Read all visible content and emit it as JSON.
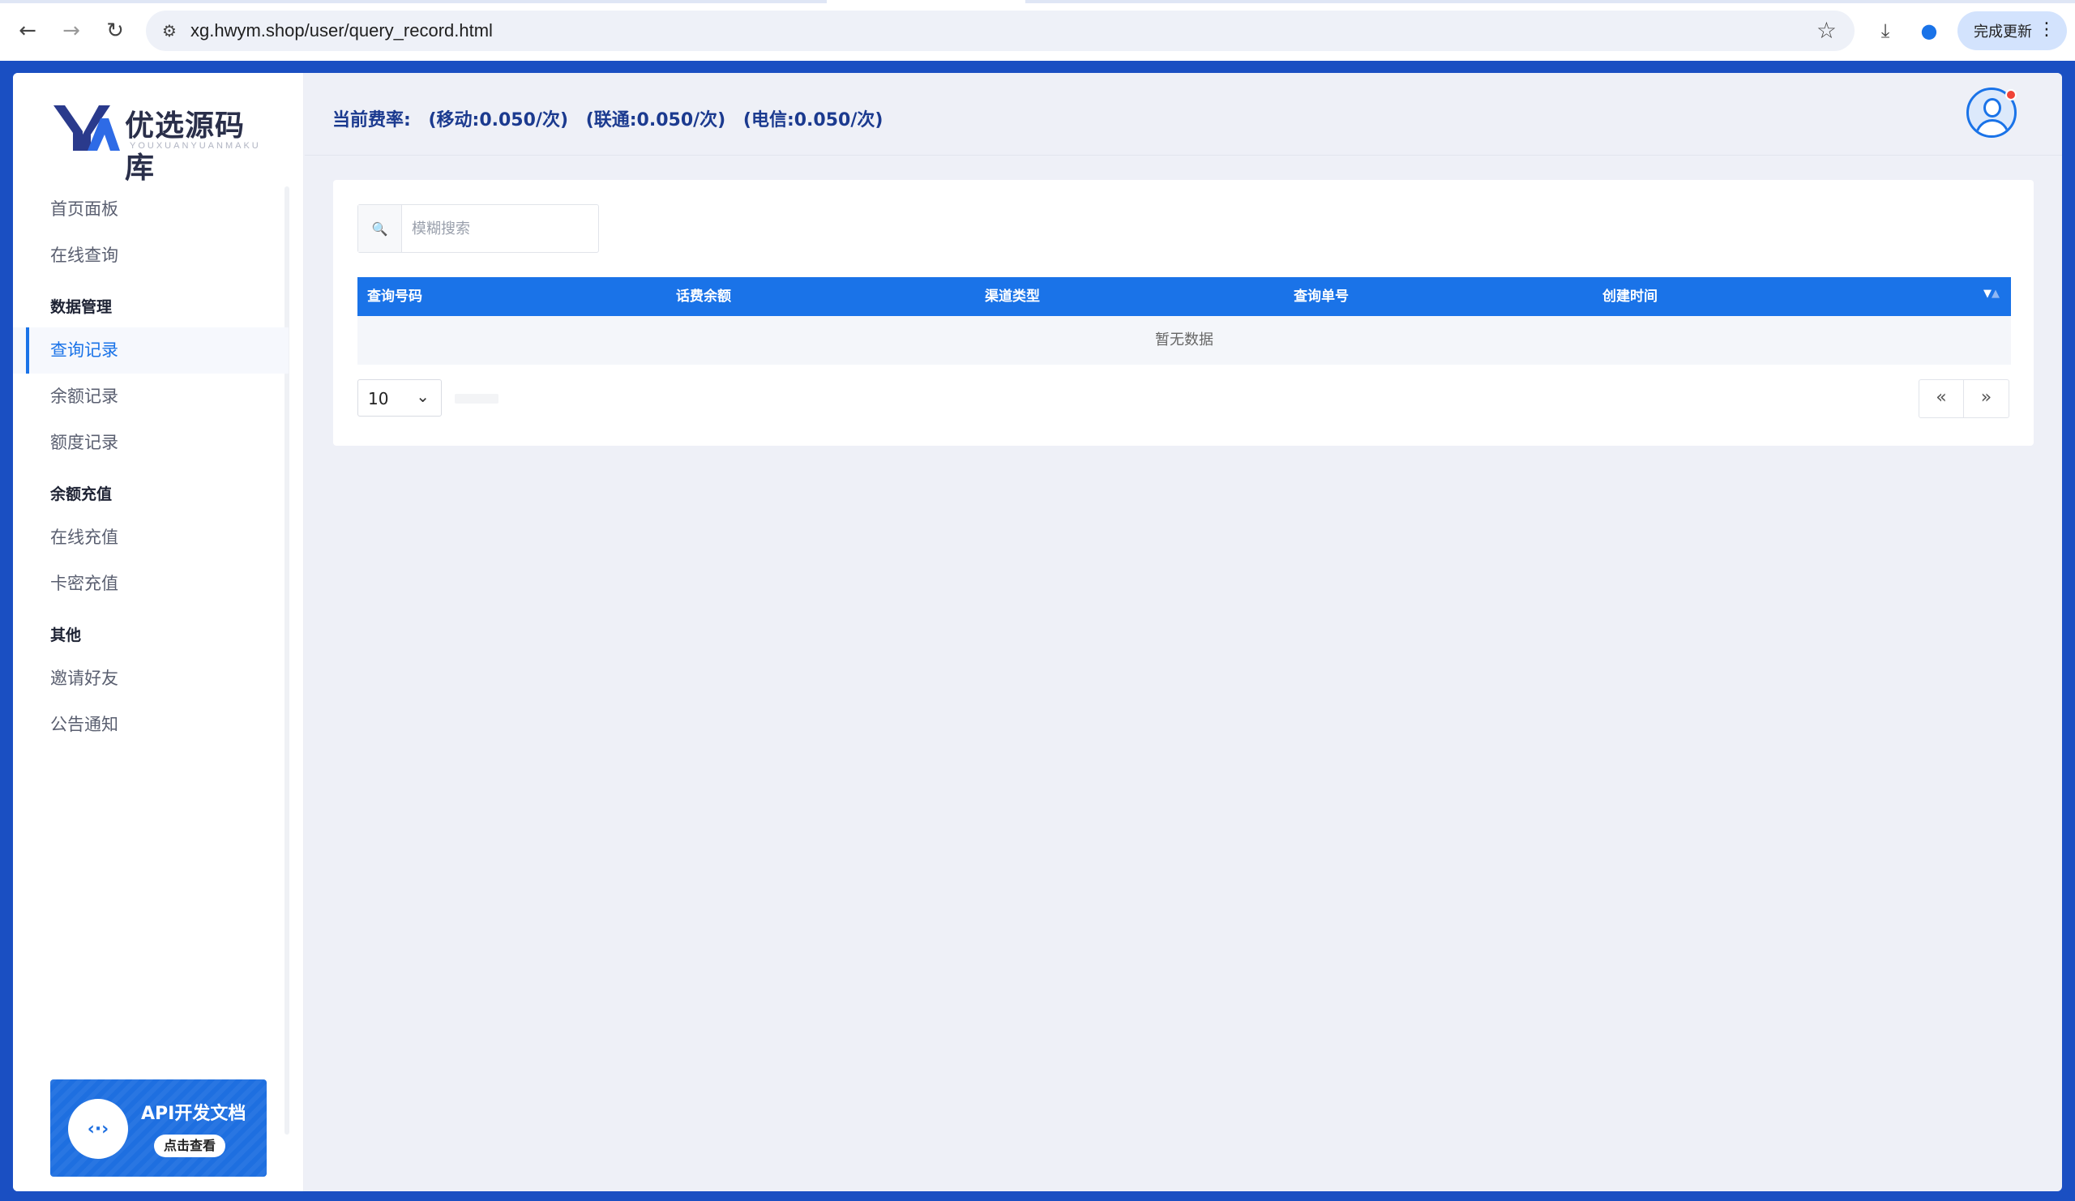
{
  "browser": {
    "url": "xg.hwym.shop/user/query_record.html",
    "update_label": "完成更新"
  },
  "logo": {
    "name": "优选源码库",
    "subtitle": "YOUXUANYUANMAKU"
  },
  "sidebar": {
    "items": [
      {
        "label": "首页面板"
      },
      {
        "label": "在线查询"
      }
    ],
    "sections": [
      {
        "title": "数据管理",
        "items": [
          "查询记录",
          "余额记录",
          "额度记录"
        ]
      },
      {
        "title": "余额充值",
        "items": [
          "在线充值",
          "卡密充值"
        ]
      },
      {
        "title": "其他",
        "items": [
          "邀请好友",
          "公告通知"
        ]
      }
    ],
    "active_item": "查询记录"
  },
  "api_card": {
    "title": "API开发文档",
    "button": "点击查看",
    "icon": "code-icon"
  },
  "header": {
    "rate_label": "当前费率:",
    "mobile": "(移动:0.050/次)",
    "unicom": "(联通:0.050/次)",
    "telecom": "(电信:0.050/次)"
  },
  "search": {
    "placeholder": "模糊搜索"
  },
  "table": {
    "columns": [
      "查询号码",
      "话费余额",
      "渠道类型",
      "查询单号",
      "创建时间"
    ],
    "empty_text": "暂无数据"
  },
  "pager": {
    "page_size": "10",
    "prev": "«",
    "next": "»"
  },
  "colors": {
    "accent": "#1a73e8",
    "frame": "#1a4fc2",
    "rate_text": "#1b3a8f"
  }
}
